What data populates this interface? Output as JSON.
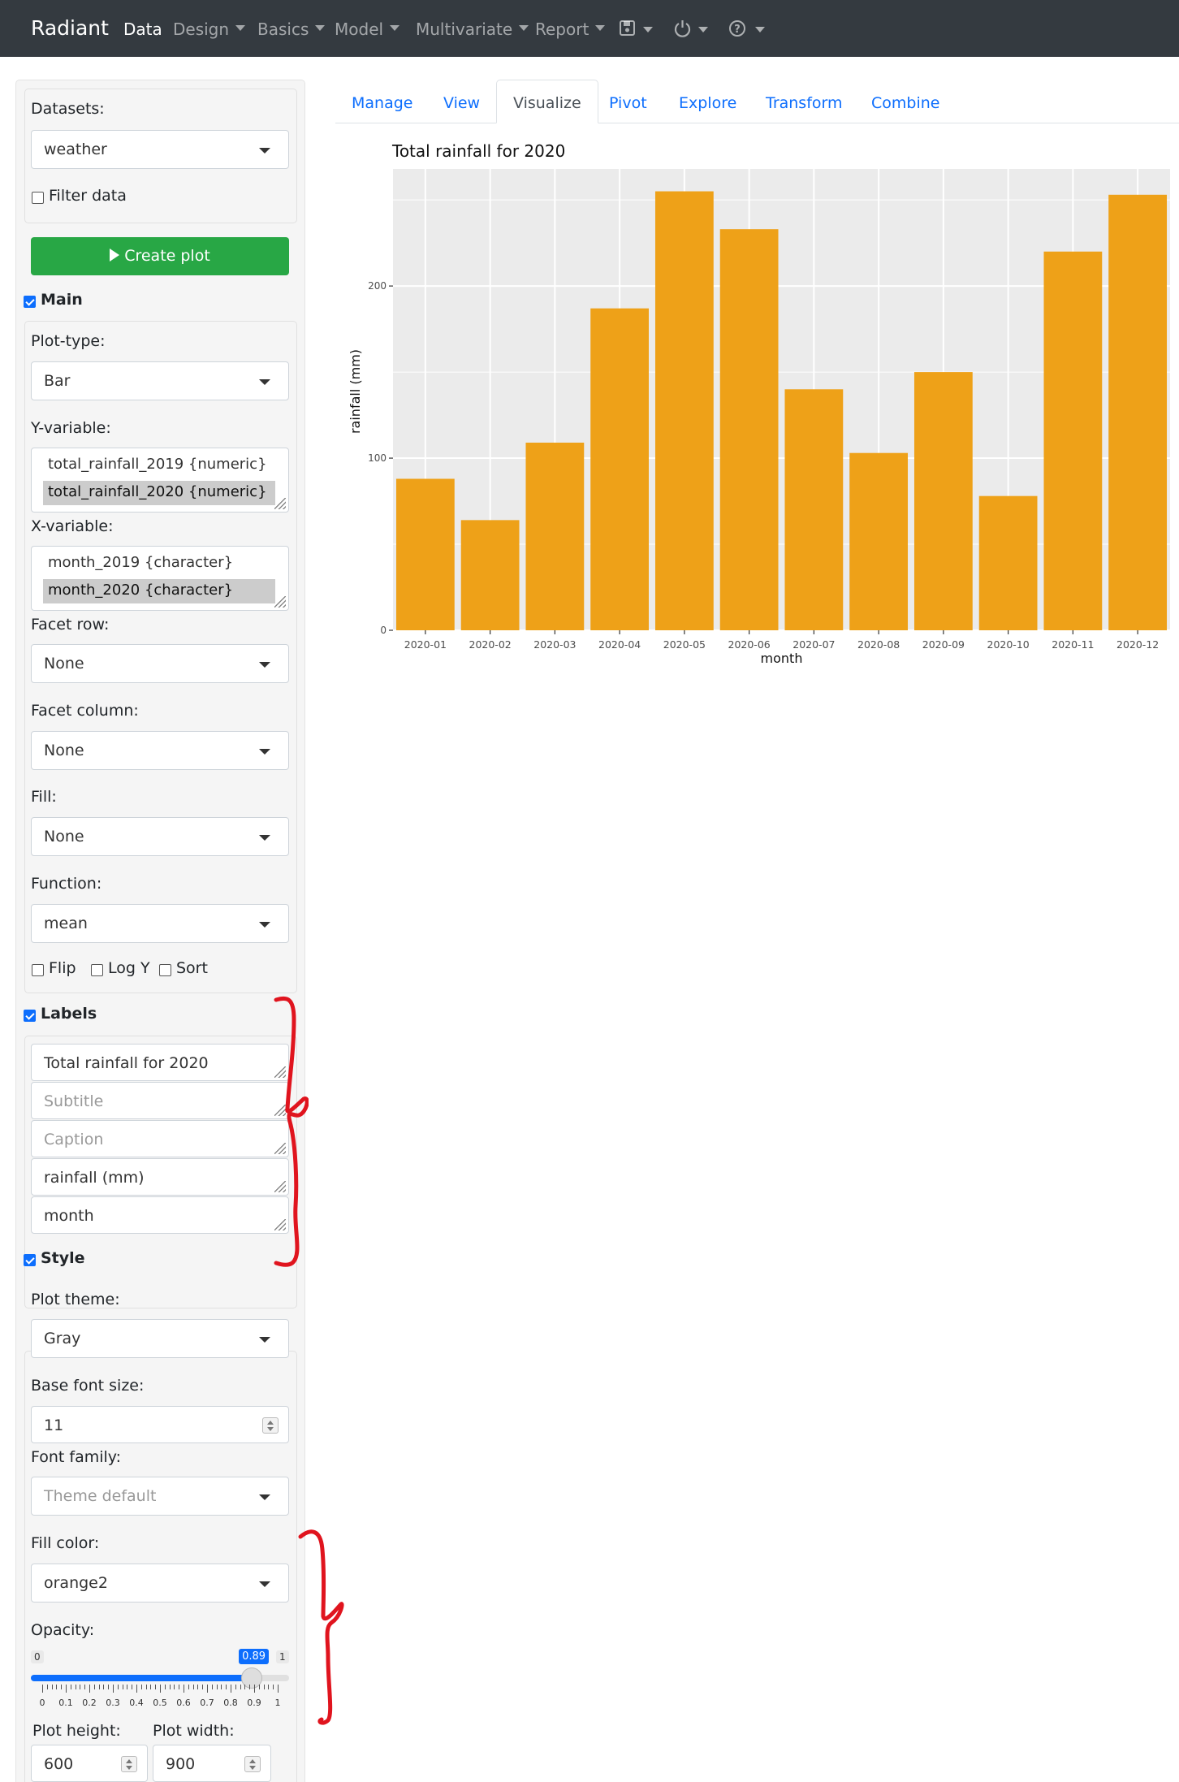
{
  "navbar": {
    "brand": "Radiant",
    "items": [
      "Data",
      "Design",
      "Basics",
      "Model",
      "Multivariate",
      "Report"
    ],
    "icons": [
      "save-icon",
      "power-icon",
      "help-icon"
    ]
  },
  "sidebar": {
    "datasets_label": "Datasets:",
    "dataset_value": "weather",
    "filter_label": "Filter data",
    "create_plot_label": "Create plot",
    "main_label": "Main",
    "plot_type_label": "Plot-type:",
    "plot_type_value": "Bar",
    "y_var_label": "Y-variable:",
    "y_options": [
      "total_rainfall_2019 {numeric}",
      "total_rainfall_2020 {numeric}"
    ],
    "x_var_label": "X-variable:",
    "x_options": [
      "month_2019 {character}",
      "month_2020 {character}"
    ],
    "facet_row_label": "Facet row:",
    "facet_row_value": "None",
    "facet_col_label": "Facet column:",
    "facet_col_value": "None",
    "fill_label": "Fill:",
    "fill_value": "None",
    "function_label": "Function:",
    "function_value": "mean",
    "flip_label": "Flip",
    "logy_label": "Log Y",
    "sort_label": "Sort",
    "labels_section": "Labels",
    "labels": {
      "title_value": "Total rainfall for 2020",
      "subtitle_placeholder": "Subtitle",
      "caption_placeholder": "Caption",
      "ylab_value": "rainfall (mm)",
      "xlab_value": "month"
    },
    "style_section": "Style",
    "plot_theme_label": "Plot theme:",
    "plot_theme_value": "Gray",
    "base_font_label": "Base font size:",
    "base_font_value": "11",
    "font_family_label": "Font family:",
    "font_family_placeholder": "Theme default",
    "fill_color_label": "Fill color:",
    "fill_color_value": "orange2",
    "opacity_label": "Opacity:",
    "opacity": {
      "min": "0",
      "max": "1",
      "value": 0.89,
      "value_text": "0.89",
      "tick_labels": [
        "0",
        "0.1",
        "0.2",
        "0.3",
        "0.4",
        "0.5",
        "0.6",
        "0.7",
        "0.8",
        "0.9",
        "1"
      ]
    },
    "plot_height_label": "Plot height:",
    "plot_height_value": "600",
    "plot_width_label": "Plot width:",
    "plot_width_value": "900"
  },
  "tabs": [
    "Manage",
    "View",
    "Visualize",
    "Pivot",
    "Explore",
    "Transform",
    "Combine"
  ],
  "active_tab": "Visualize",
  "colors": {
    "navbar": "#343a40",
    "create_button": "#28a745",
    "link": "#0d6efd",
    "bar_fill": "#EEA118",
    "panel_bg": "#EBEBEB",
    "annotation": "#e0141e"
  },
  "chart_data": {
    "type": "bar",
    "title": "Total rainfall for 2020",
    "xlabel": "month",
    "ylabel": "rainfall (mm)",
    "categories": [
      "2020-01",
      "2020-02",
      "2020-03",
      "2020-04",
      "2020-05",
      "2020-06",
      "2020-07",
      "2020-08",
      "2020-09",
      "2020-10",
      "2020-11",
      "2020-12"
    ],
    "values": [
      88,
      64,
      109,
      187,
      255,
      233,
      140,
      103,
      150,
      78,
      220,
      253
    ],
    "ylim": [
      0,
      268
    ],
    "yticks": [
      0,
      100,
      200
    ],
    "grid": true,
    "theme": "gray"
  }
}
